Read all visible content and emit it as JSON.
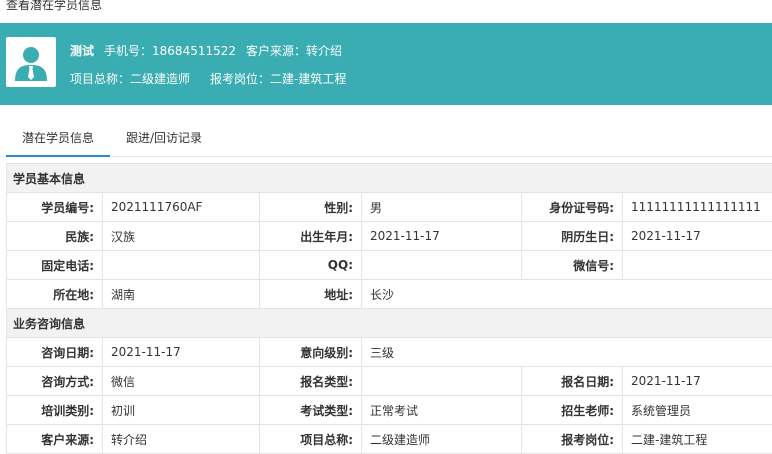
{
  "page": {
    "title": "查看潜在学员信息"
  },
  "header": {
    "name": "测试",
    "phone_label": "手机号：",
    "phone": "18684511522",
    "source_label": "客户来源：",
    "source": "转介绍",
    "project_label": "项目总称：",
    "project": "二级建造师",
    "position_label": "报考岗位：",
    "position": "二建-建筑工程",
    "avatar_icon": "user-avatar-icon",
    "accent_color": "#3aadb3"
  },
  "tabs": [
    {
      "label": "潜在学员信息",
      "active": true
    },
    {
      "label": "跟进/回访记录",
      "active": false
    }
  ],
  "basic": {
    "section_title": "学员基本信息",
    "rows": [
      [
        {
          "label": "学员编号:",
          "value": "2021111760AF"
        },
        {
          "label": "性别:",
          "value": "男"
        },
        {
          "label": "身份证号码:",
          "value": "11111111111111111"
        }
      ],
      [
        {
          "label": "民族:",
          "value": "汉族"
        },
        {
          "label": "出生年月:",
          "value": "2021-11-17"
        },
        {
          "label": "阴历生日:",
          "value": "2021-11-17"
        }
      ],
      [
        {
          "label": "固定电话:",
          "value": ""
        },
        {
          "label": "QQ:",
          "value": ""
        },
        {
          "label": "微信号:",
          "value": ""
        }
      ],
      [
        {
          "label": "所在地:",
          "value": "湖南"
        },
        {
          "label": "地址:",
          "value": "长沙"
        }
      ]
    ]
  },
  "consult": {
    "section_title": "业务咨询信息",
    "rows": [
      [
        {
          "label": "咨询日期:",
          "value": "2021-11-17"
        },
        {
          "label": "意向级别:",
          "value": "三级"
        }
      ],
      [
        {
          "label": "咨询方式:",
          "value": "微信"
        },
        {
          "label": "报名类型:",
          "value": ""
        },
        {
          "label": "报名日期:",
          "value": "2021-11-17"
        }
      ],
      [
        {
          "label": "培训类别:",
          "value": "初训"
        },
        {
          "label": "考试类型:",
          "value": "正常考试"
        },
        {
          "label": "招生老师:",
          "value": "系统管理员"
        }
      ],
      [
        {
          "label": "客户来源:",
          "value": "转介绍"
        },
        {
          "label": "项目总称:",
          "value": "二级建造师"
        },
        {
          "label": "报考岗位:",
          "value": "二建-建筑工程"
        }
      ]
    ]
  }
}
